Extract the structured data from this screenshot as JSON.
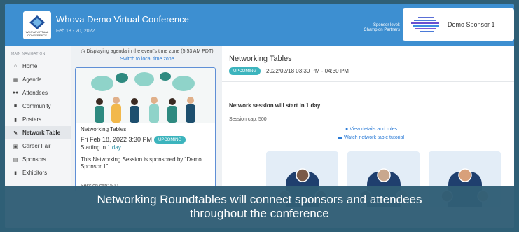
{
  "header": {
    "title": "Whova Demo Virtual Conference",
    "dates": "Feb 18 - 20, 2022",
    "logo_text": "WHOVA VIRTUAL CONFERENCE",
    "sponsor_level_line1": "Sponsor level:",
    "sponsor_level_line2": "Champion Partners",
    "sponsor_name": "Demo Sponsor 1"
  },
  "sidebar": {
    "heading": "MAIN NAVIGATION",
    "items": [
      {
        "label": "Home",
        "icon": "home-icon"
      },
      {
        "label": "Agenda",
        "icon": "calendar-icon"
      },
      {
        "label": "Attendees",
        "icon": "people-icon"
      },
      {
        "label": "Community",
        "icon": "chat-icon"
      },
      {
        "label": "Posters",
        "icon": "bookmark-icon"
      },
      {
        "label": "Network Table",
        "icon": "handshake-icon",
        "active": true
      },
      {
        "label": "Career Fair",
        "icon": "briefcase-icon"
      },
      {
        "label": "Sponsors",
        "icon": "badge-icon"
      },
      {
        "label": "Exhibitors",
        "icon": "flag-icon"
      }
    ]
  },
  "timezone": {
    "note": "Displaying agenda in the event's time zone (5:53 AM PDT)",
    "link": "Switch to local time zone"
  },
  "session_card": {
    "title": "Networking Tables",
    "time": "Fri Feb 18, 2022 3:30 PM",
    "badge": "UPCOMING",
    "starting_prefix": "Starting in ",
    "starting_value": "1 day",
    "description": "This Networking Session is sponsored by \"Demo Sponsor 1\"",
    "cap": "Session cap: 500"
  },
  "detail": {
    "title": "Networking Tables",
    "badge": "UPCOMING",
    "time": "2022/02/18 03:30 PM - 04:30 PM",
    "start_message": "Network session will start in 1 day",
    "cap": "Session cap: 500",
    "view_link": "View details and rules",
    "tutorial_link": "Watch network table tutorial"
  },
  "caption": {
    "line1": "Networking Roundtables will connect sponsors and attendees",
    "line2": "throughout the conference"
  },
  "colors": {
    "header_blue": "#3d8fd1",
    "badge_teal": "#3cb4bd",
    "link_blue": "#2b7bd6",
    "caption_bg": "#315e76"
  }
}
